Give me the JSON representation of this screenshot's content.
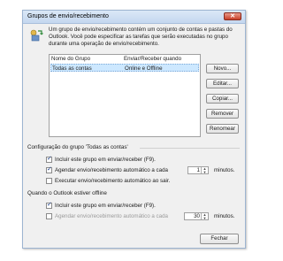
{
  "dialog": {
    "title": "Grupos de envio/recebimento",
    "description": "Um grupo de envio/recebimento contém um conjunto de contas e pastas do Outlook. Você pode especificar as tarefas que serão executadas no grupo durante uma operação de envio/recebimento."
  },
  "list": {
    "col_name": "Nome do Grupo",
    "col_when": "Enviar/Receber quando",
    "rows": [
      {
        "name": "Todas as contas",
        "when": "Online e Offline"
      }
    ]
  },
  "buttons": {
    "new": "Novo...",
    "edit": "Editar...",
    "copy": "Copiar...",
    "remove": "Remover",
    "rename": "Renomear",
    "close": "Fechar"
  },
  "online": {
    "section": "Configuração do grupo 'Todas as contas'",
    "include": "Incluir este grupo em enviar/receber (F9).",
    "schedule": "Agendar envio/recebimento automático a cada",
    "schedule_value": "1",
    "minutes": "minutos.",
    "on_exit": "Executar envio/recebimento automático ao sair."
  },
  "offline": {
    "section": "Quando o Outlook estiver offline",
    "include": "Incluir este grupo em enviar/receber (F9).",
    "schedule": "Agendar envio/recebimento automático a cada",
    "schedule_value": "30",
    "minutes": "minutos."
  },
  "colors": {
    "selection": "#cde8ff",
    "close_button": "#c8402a"
  }
}
